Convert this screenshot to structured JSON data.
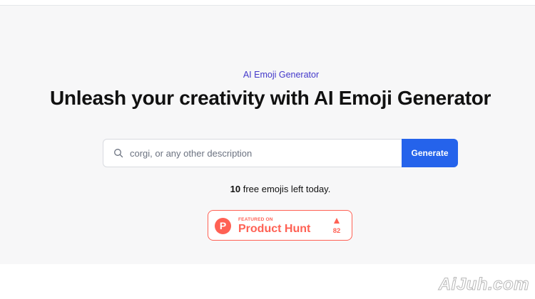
{
  "hero": {
    "eyebrow": "AI Emoji Generator",
    "headline": "Unleash your creativity with AI Emoji Generator"
  },
  "search": {
    "placeholder": "corgi, or any other description",
    "value": "",
    "icon": "search-icon",
    "button_label": "Generate"
  },
  "quota": {
    "count": "10",
    "text": " free emojis left today."
  },
  "product_hunt": {
    "logo_letter": "P",
    "featured_label": "FEATURED ON",
    "name": "Product Hunt",
    "votes": "82",
    "accent": "#ff6154"
  },
  "watermark": "AiJuh.com",
  "colors": {
    "accent": "#2563eb",
    "eyebrow": "#4338ca",
    "hero_bg": "#f7f7f8"
  }
}
